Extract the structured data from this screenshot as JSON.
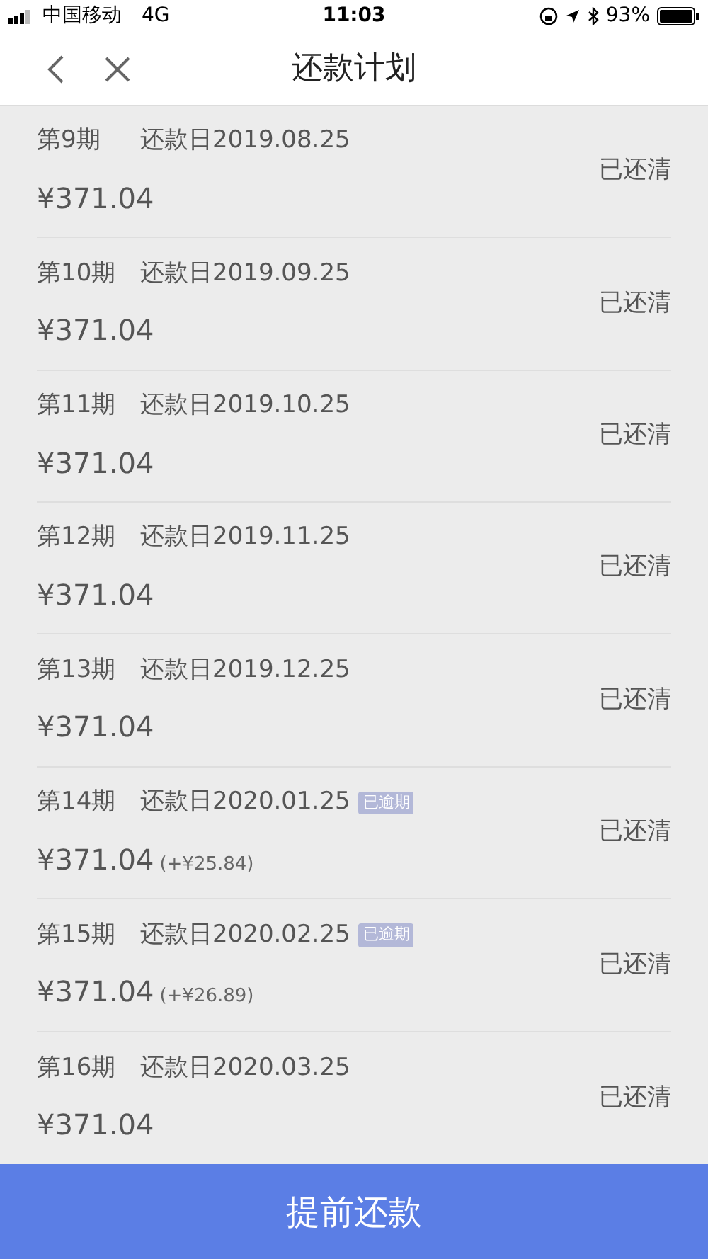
{
  "status_bar": {
    "carrier": "中国移动",
    "network": "4G",
    "time": "11:03",
    "battery": "93%"
  },
  "nav": {
    "title": "还款计划"
  },
  "rows": [
    {
      "period": "第9期",
      "due": "还款日2019.08.25",
      "amount": "¥371.04",
      "status": "已还清"
    },
    {
      "period": "第10期",
      "due": "还款日2019.09.25",
      "amount": "¥371.04",
      "status": "已还清"
    },
    {
      "period": "第11期",
      "due": "还款日2019.10.25",
      "amount": "¥371.04",
      "status": "已还清"
    },
    {
      "period": "第12期",
      "due": "还款日2019.11.25",
      "amount": "¥371.04",
      "status": "已还清"
    },
    {
      "period": "第13期",
      "due": "还款日2019.12.25",
      "amount": "¥371.04",
      "status": "已还清"
    },
    {
      "period": "第14期",
      "due": "还款日2020.01.25",
      "badge": "已逾期",
      "amount": "¥371.04",
      "extra": "(+¥25.84)",
      "status": "已还清"
    },
    {
      "period": "第15期",
      "due": "还款日2020.02.25",
      "badge": "已逾期",
      "amount": "¥371.04",
      "extra": "(+¥26.89)",
      "status": "已还清"
    },
    {
      "period": "第16期",
      "due": "还款日2020.03.25",
      "amount": "¥371.04",
      "status": "已还清"
    }
  ],
  "action_button": "提前还款"
}
